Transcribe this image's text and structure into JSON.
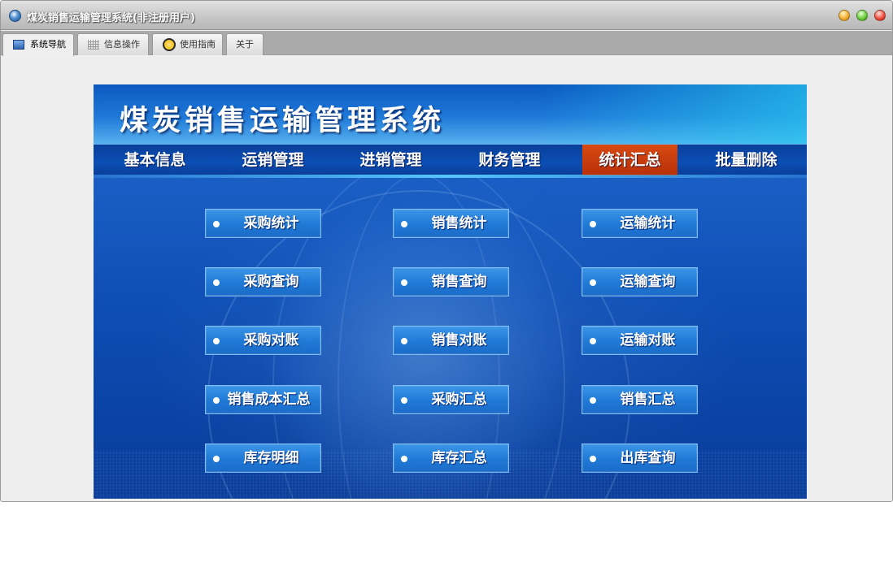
{
  "window": {
    "title": "煤炭销售运输管理系统(非注册用户)"
  },
  "tabs": [
    {
      "label": "系统导航",
      "icon": "monitor-icon",
      "active": true
    },
    {
      "label": "信息操作",
      "icon": "grid-icon",
      "active": false
    },
    {
      "label": "使用指南",
      "icon": "clock-icon",
      "active": false
    },
    {
      "label": "关于",
      "icon": "",
      "active": false
    }
  ],
  "banner": {
    "title": "煤炭销售运输管理系统"
  },
  "menu": [
    {
      "label": "基本信息",
      "active": false
    },
    {
      "label": "运销管理",
      "active": false
    },
    {
      "label": "进销管理",
      "active": false
    },
    {
      "label": "财务管理",
      "active": false
    },
    {
      "label": "统计汇总",
      "active": true
    },
    {
      "label": "批量删除",
      "active": false
    }
  ],
  "buttons": {
    "purchase_stats": "采购统计",
    "sales_stats": "销售统计",
    "transport_stats": "运输统计",
    "purchase_query": "采购查询",
    "sales_query": "销售查询",
    "transport_query": "运输查询",
    "purchase_reconcile": "采购对账",
    "sales_reconcile": "销售对账",
    "transport_reconcile": "运输对账",
    "sales_cost_summary": "销售成本汇总",
    "purchase_summary": "采购汇总",
    "sales_summary": "销售汇总",
    "inventory_detail": "库存明细",
    "inventory_summary": "库存汇总",
    "outbound_query": "出库查询"
  },
  "colors": {
    "active_menu": "#c83a0c",
    "panel_blue": "#0f4fb6",
    "button_blue": "#2079d6"
  }
}
